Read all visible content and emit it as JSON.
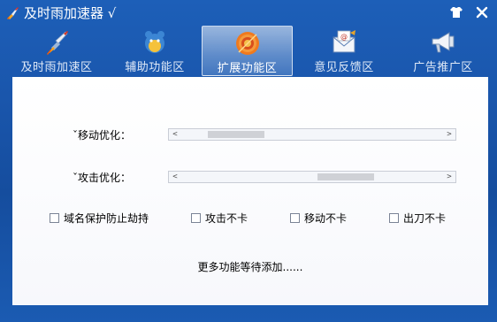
{
  "window": {
    "title": "及时雨加速器 √",
    "colors": {
      "frame": "#1a56ac",
      "panel": "#ffffff",
      "active_icon": "#f07a1e"
    }
  },
  "titlebar": {
    "app_icon": "rocket-icon",
    "skin_icon": "shirt-icon",
    "close_icon": "close-icon"
  },
  "tabs": [
    {
      "label": "及时雨加速区",
      "icon": "rocket-icon",
      "active": false
    },
    {
      "label": "辅助功能区",
      "icon": "bear-icon",
      "active": false
    },
    {
      "label": "扩展功能区",
      "icon": "target-icon",
      "active": true
    },
    {
      "label": "意见反馈区",
      "icon": "mail-icon",
      "active": false
    },
    {
      "label": "广告推广区",
      "icon": "megaphone-icon",
      "active": false
    }
  ],
  "sliders": [
    {
      "label": "ˇ移动优化：",
      "left_arrow": "<",
      "right_arrow": ">",
      "position": 0.08
    },
    {
      "label": "ˇ攻击优化：",
      "left_arrow": "<",
      "right_arrow": ">",
      "position": 0.55
    }
  ],
  "checkboxes": [
    {
      "label": "域名保护防止劫持",
      "checked": false
    },
    {
      "label": "攻击不卡",
      "checked": false
    },
    {
      "label": "移动不卡",
      "checked": false
    },
    {
      "label": "出刀不卡",
      "checked": false
    }
  ],
  "footer": {
    "more_text": "更多功能等待添加......"
  }
}
